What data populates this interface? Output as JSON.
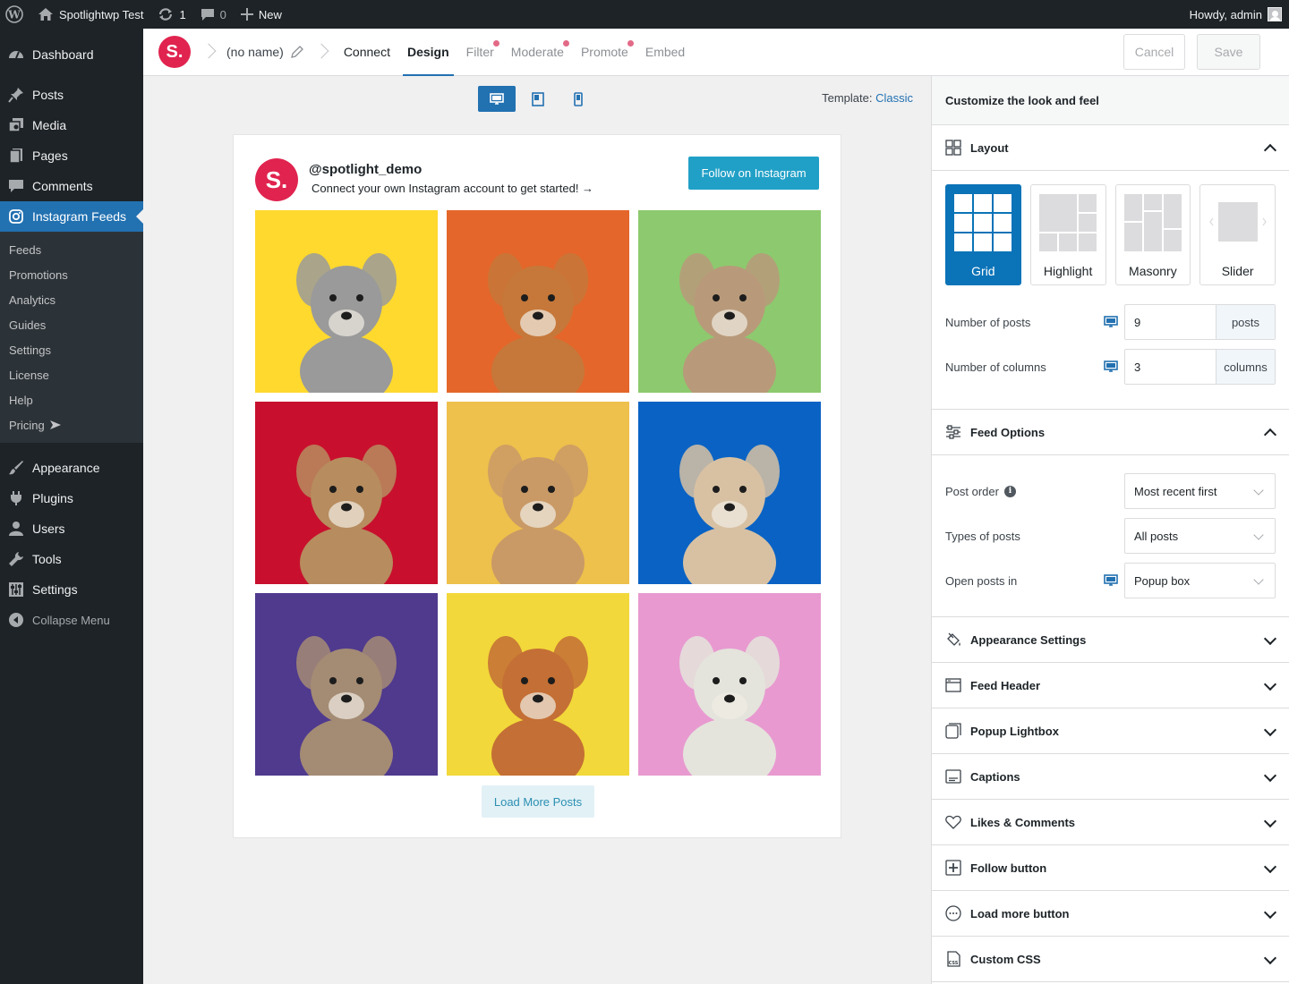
{
  "adminbar": {
    "site_name": "Spotlightwp Test",
    "updates_count": "1",
    "comments_count": "0",
    "new_label": "New",
    "greeting": "Howdy, admin"
  },
  "sidebar": {
    "items_top": [
      {
        "label": "Dashboard",
        "icon": "dashboard-icon"
      },
      {
        "label": "Posts",
        "icon": "pin-icon"
      },
      {
        "label": "Media",
        "icon": "media-icon"
      },
      {
        "label": "Pages",
        "icon": "pages-icon"
      },
      {
        "label": "Comments",
        "icon": "comment-icon"
      },
      {
        "label": "Instagram Feeds",
        "icon": "instagram-icon"
      }
    ],
    "submenu": [
      "Feeds",
      "Promotions",
      "Analytics",
      "Guides",
      "Settings",
      "License",
      "Help",
      "Pricing"
    ],
    "items_bottom": [
      {
        "label": "Appearance",
        "icon": "brush-icon"
      },
      {
        "label": "Plugins",
        "icon": "plug-icon"
      },
      {
        "label": "Users",
        "icon": "user-icon"
      },
      {
        "label": "Tools",
        "icon": "wrench-icon"
      },
      {
        "label": "Settings",
        "icon": "sliders-icon"
      },
      {
        "label": "Collapse Menu",
        "icon": "collapse-icon"
      }
    ]
  },
  "toolbar": {
    "logo": "S.",
    "feed_name": "(no name)",
    "tabs": [
      "Connect",
      "Design",
      "Filter",
      "Moderate",
      "Promote",
      "Embed"
    ],
    "active_tab": "Design",
    "cancel_label": "Cancel",
    "save_label": "Save"
  },
  "preview": {
    "template_label": "Template:",
    "template_value": "Classic",
    "feed": {
      "avatar_text": "S.",
      "username": "@spotlight_demo",
      "bio": "Connect your own Instagram account to get started! →",
      "follow_label": "Follow on Instagram",
      "load_more_label": "Load More Posts"
    },
    "posts_bg_colors": [
      "#ffd92e",
      "#e4662a",
      "#8dc96e",
      "#c8102e",
      "#eec04c",
      "#0a63c4",
      "#4f3a8e",
      "#f2d83a",
      "#e89ad0"
    ]
  },
  "panel": {
    "title": "Customize the look and feel",
    "layout_section": "Layout",
    "layouts": [
      "Grid",
      "Highlight",
      "Masonry",
      "Slider"
    ],
    "active_layout": "Grid",
    "num_posts_label": "Number of posts",
    "num_posts_value": "9",
    "num_posts_unit": "posts",
    "num_cols_label": "Number of columns",
    "num_cols_value": "3",
    "num_cols_unit": "columns",
    "feed_options_section": "Feed Options",
    "post_order_label": "Post order",
    "post_order_value": "Most recent first",
    "types_label": "Types of posts",
    "types_value": "All posts",
    "open_label": "Open posts in",
    "open_value": "Popup box",
    "collapsed_sections": [
      {
        "label": "Appearance Settings",
        "icon": "paint-bucket-icon"
      },
      {
        "label": "Feed Header",
        "icon": "window-icon"
      },
      {
        "label": "Popup Lightbox",
        "icon": "lightbox-icon"
      },
      {
        "label": "Captions",
        "icon": "captions-icon"
      },
      {
        "label": "Likes & Comments",
        "icon": "heart-icon"
      },
      {
        "label": "Follow button",
        "icon": "plus-box-icon"
      },
      {
        "label": "Load more button",
        "icon": "dots-circle-icon"
      },
      {
        "label": "Custom CSS",
        "icon": "css-file-icon"
      }
    ],
    "accent_color": "#2271b1"
  }
}
